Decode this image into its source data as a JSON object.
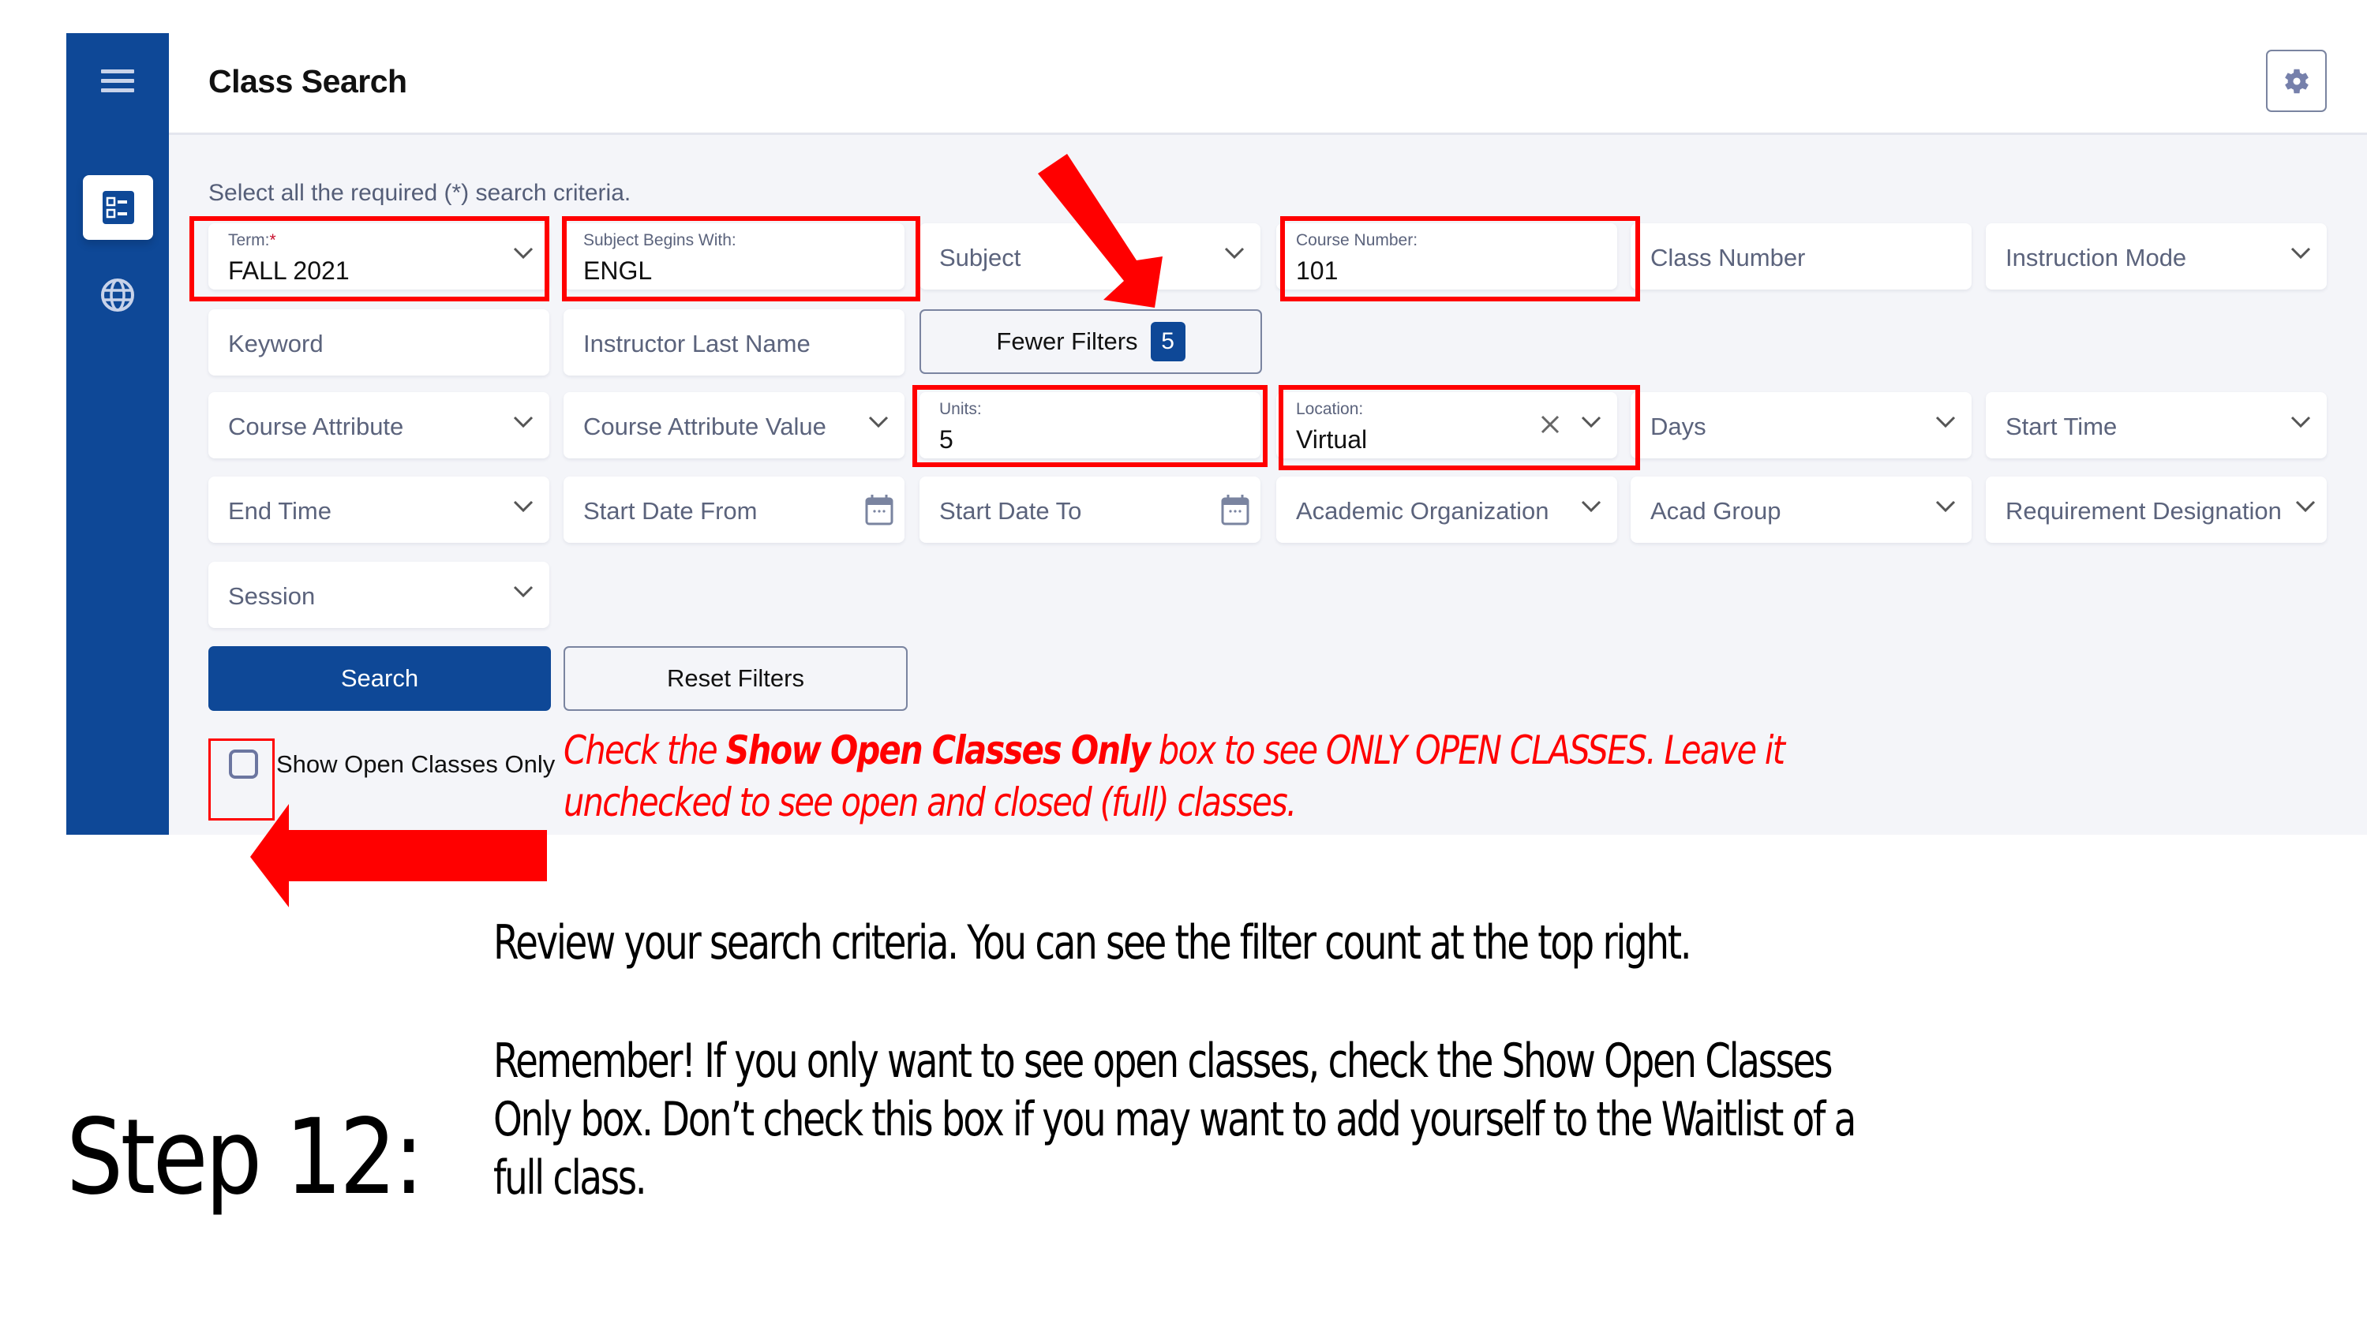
{
  "app": {
    "title": "Class Search",
    "instructions": "Select all the required (*) search criteria.",
    "sidebar": {
      "items": [
        {
          "name": "menu",
          "icon": "hamburger-menu-icon"
        },
        {
          "name": "class-search",
          "icon": "checklist-icon",
          "active": true
        },
        {
          "name": "language",
          "icon": "globe-icon"
        }
      ]
    },
    "header": {
      "settings_icon": "gear-icon"
    },
    "filters": {
      "term": {
        "label": "Term:",
        "required_mark": "*",
        "value": "FALL 2021"
      },
      "subject_begins_with": {
        "label": "Subject Begins With:",
        "value": "ENGL"
      },
      "subject": {
        "placeholder": "Subject"
      },
      "course_number": {
        "label": "Course Number:",
        "value": "101"
      },
      "class_number": {
        "placeholder": "Class Number"
      },
      "instruction_mode": {
        "placeholder": "Instruction Mode"
      },
      "keyword": {
        "placeholder": "Keyword"
      },
      "instructor_last_name": {
        "placeholder": "Instructor Last Name"
      },
      "course_attribute": {
        "placeholder": "Course Attribute"
      },
      "course_attribute_value": {
        "placeholder": "Course Attribute Value"
      },
      "units": {
        "label": "Units:",
        "value": "5"
      },
      "location": {
        "label": "Location:",
        "value": "Virtual"
      },
      "days": {
        "placeholder": "Days"
      },
      "start_time": {
        "placeholder": "Start Time"
      },
      "end_time": {
        "placeholder": "End Time"
      },
      "start_date_from": {
        "placeholder": "Start Date From"
      },
      "start_date_to": {
        "placeholder": "Start Date To"
      },
      "academic_organization": {
        "placeholder": "Academic Organization"
      },
      "acad_group": {
        "placeholder": "Acad Group"
      },
      "requirement_designation": {
        "placeholder": "Requirement Designation"
      },
      "session": {
        "placeholder": "Session"
      }
    },
    "fewer_filters": {
      "label": "Fewer Filters",
      "count": "5"
    },
    "search_button": "Search",
    "reset_button": "Reset Filters",
    "show_open_only": {
      "label": "Show Open Classes Only",
      "checked": false
    }
  },
  "annotations": {
    "note_line1_a": "Check the ",
    "note_line1_b": "Show Open Classes Only",
    "note_line1_c": " box to see ONLY OPEN CLASSES. Leave it",
    "note_line2": "unchecked to see open and closed (full) classes.",
    "highlight_color": "#ff0000"
  },
  "slide": {
    "step_label": "Step 12:",
    "para1": "Review your search criteria. You can see the filter count at the top right.",
    "para2_line1_a": "Remember! If you only want to see open classes, check the ",
    "para2_line1_b": "Show Open Classes",
    "para2_line2_a": "Only",
    "para2_line2_b": " box. Don’t check this box if you may want to add yourself to the Waitlist of a",
    "para2_line3": "full class."
  },
  "colors": {
    "brand": "#0e4897",
    "background": "#f4f5f9",
    "placeholder": "#5b637c"
  }
}
